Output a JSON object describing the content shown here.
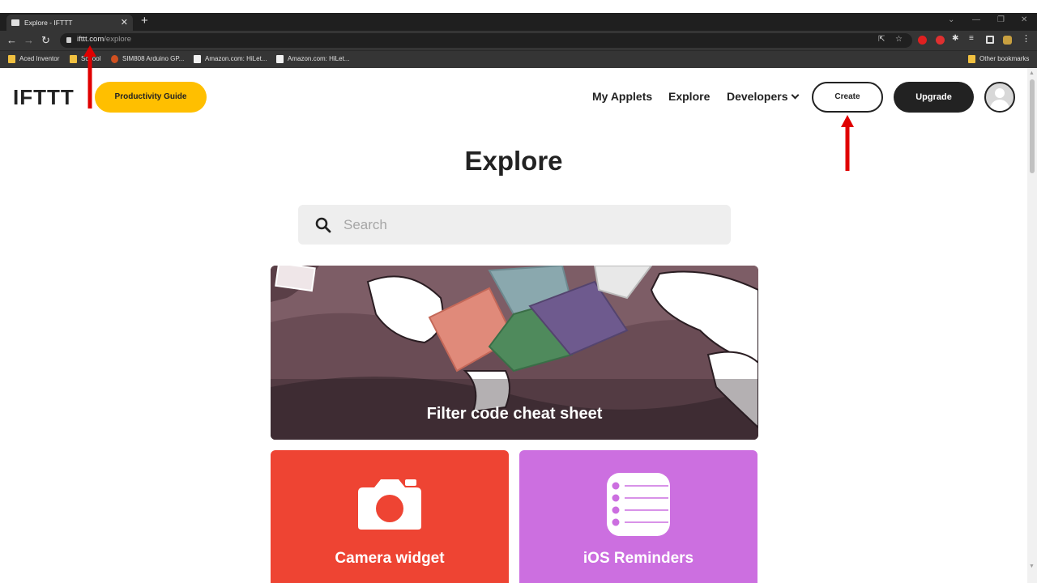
{
  "browser": {
    "tab_title": "Explore - IFTTT",
    "tab_close": "✕",
    "new_tab": "+",
    "url_host": "ifttt.com",
    "url_path": "/explore",
    "bookmarks": [
      {
        "label": "Aced Inventor"
      },
      {
        "label": "School"
      },
      {
        "label": "SIM808 Arduino GP..."
      },
      {
        "label": "Amazon.com: HiLet..."
      },
      {
        "label": "Amazon.com: HiLet..."
      }
    ],
    "other_bookmarks": "Other bookmarks"
  },
  "header": {
    "logo": "IFTTT",
    "promo_label": "Productivity Guide",
    "nav": {
      "my_applets": "My Applets",
      "explore": "Explore",
      "developers": "Developers"
    },
    "create_label": "Create",
    "upgrade_label": "Upgrade"
  },
  "main": {
    "title": "Explore",
    "search_placeholder": "Search",
    "hero_label": "Filter code cheat sheet",
    "cards": [
      {
        "label": "Camera widget",
        "color": "#ee4433"
      },
      {
        "label": "iOS Reminders",
        "color": "#cc6fe0"
      }
    ]
  },
  "colors": {
    "accent": "#ffbf00",
    "annotation_arrow": "#e00000",
    "dark": "#222222"
  }
}
